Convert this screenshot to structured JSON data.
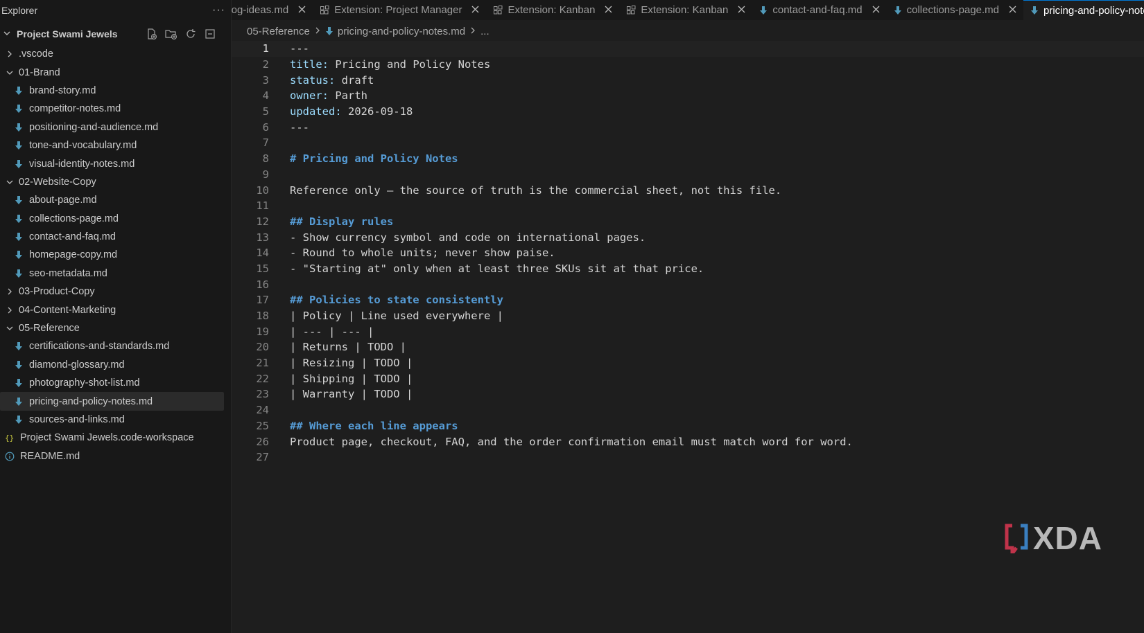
{
  "sidebar": {
    "title": "Explorer",
    "more_label": "···",
    "workspace": "Project Swami Jewels",
    "tree": [
      {
        "label": ".vscode",
        "kind": "folder",
        "expanded": false,
        "level": 0
      },
      {
        "label": "01-Brand",
        "kind": "folder",
        "expanded": true,
        "level": 0
      },
      {
        "label": "brand-story.md",
        "kind": "md",
        "level": 1
      },
      {
        "label": "competitor-notes.md",
        "kind": "md",
        "level": 1
      },
      {
        "label": "positioning-and-audience.md",
        "kind": "md",
        "level": 1
      },
      {
        "label": "tone-and-vocabulary.md",
        "kind": "md",
        "level": 1
      },
      {
        "label": "visual-identity-notes.md",
        "kind": "md",
        "level": 1
      },
      {
        "label": "02-Website-Copy",
        "kind": "folder",
        "expanded": true,
        "level": 0
      },
      {
        "label": "about-page.md",
        "kind": "md",
        "level": 1
      },
      {
        "label": "collections-page.md",
        "kind": "md",
        "level": 1
      },
      {
        "label": "contact-and-faq.md",
        "kind": "md",
        "level": 1
      },
      {
        "label": "homepage-copy.md",
        "kind": "md",
        "level": 1
      },
      {
        "label": "seo-metadata.md",
        "kind": "md",
        "level": 1
      },
      {
        "label": "03-Product-Copy",
        "kind": "folder",
        "expanded": false,
        "level": 0
      },
      {
        "label": "04-Content-Marketing",
        "kind": "folder",
        "expanded": false,
        "level": 0
      },
      {
        "label": "05-Reference",
        "kind": "folder",
        "expanded": true,
        "level": 0
      },
      {
        "label": "certifications-and-standards.md",
        "kind": "md",
        "level": 1
      },
      {
        "label": "diamond-glossary.md",
        "kind": "md",
        "level": 1
      },
      {
        "label": "photography-shot-list.md",
        "kind": "md",
        "level": 1
      },
      {
        "label": "pricing-and-policy-notes.md",
        "kind": "md",
        "level": 1,
        "selected": true
      },
      {
        "label": "sources-and-links.md",
        "kind": "md",
        "level": 1
      },
      {
        "label": "Project Swami Jewels.code-workspace",
        "kind": "workspace",
        "level": 0
      },
      {
        "label": "README.md",
        "kind": "info",
        "level": 0
      }
    ]
  },
  "tabs": [
    {
      "label": "blog-ideas.md",
      "kind": "md",
      "active": false
    },
    {
      "label": "Extension: Project Manager",
      "kind": "ext",
      "active": false
    },
    {
      "label": "Extension: Kanban",
      "kind": "ext",
      "active": false
    },
    {
      "label": "Extension: Kanban",
      "kind": "ext",
      "active": false
    },
    {
      "label": "contact-and-faq.md",
      "kind": "md",
      "active": false
    },
    {
      "label": "collections-page.md",
      "kind": "md",
      "active": false
    },
    {
      "label": "pricing-and-policy-notes.md",
      "kind": "md",
      "active": true
    }
  ],
  "breadcrumb": {
    "folder": "05-Reference",
    "file": "pricing-and-policy-notes.md",
    "more": "..."
  },
  "editor": {
    "current_line": 1,
    "lines": [
      {
        "n": "1",
        "type": "plain",
        "text": "---"
      },
      {
        "n": "2",
        "type": "kv",
        "key": "title:",
        "value": " Pricing and Policy Notes"
      },
      {
        "n": "3",
        "type": "kv",
        "key": "status:",
        "value": " draft"
      },
      {
        "n": "4",
        "type": "kv",
        "key": "owner:",
        "value": " Parth"
      },
      {
        "n": "5",
        "type": "kv",
        "key": "updated:",
        "value": " 2026-09-18"
      },
      {
        "n": "6",
        "type": "plain",
        "text": "---"
      },
      {
        "n": "7",
        "type": "plain",
        "text": ""
      },
      {
        "n": "8",
        "type": "heading",
        "text": "# Pricing and Policy Notes"
      },
      {
        "n": "9",
        "type": "plain",
        "text": ""
      },
      {
        "n": "10",
        "type": "plain",
        "text": "Reference only — the source of truth is the commercial sheet, not this file."
      },
      {
        "n": "11",
        "type": "plain",
        "text": ""
      },
      {
        "n": "12",
        "type": "heading",
        "text": "## Display rules"
      },
      {
        "n": "13",
        "type": "plain",
        "text": "- Show currency symbol and code on international pages."
      },
      {
        "n": "14",
        "type": "plain",
        "text": "- Round to whole units; never show paise."
      },
      {
        "n": "15",
        "type": "plain",
        "text": "- \"Starting at\" only when at least three SKUs sit at that price."
      },
      {
        "n": "16",
        "type": "plain",
        "text": ""
      },
      {
        "n": "17",
        "type": "heading",
        "text": "## Policies to state consistently"
      },
      {
        "n": "18",
        "type": "plain",
        "text": "| Policy | Line used everywhere |"
      },
      {
        "n": "19",
        "type": "plain",
        "text": "| --- | --- |"
      },
      {
        "n": "20",
        "type": "plain",
        "text": "| Returns | TODO |"
      },
      {
        "n": "21",
        "type": "plain",
        "text": "| Resizing | TODO |"
      },
      {
        "n": "22",
        "type": "plain",
        "text": "| Shipping | TODO |"
      },
      {
        "n": "23",
        "type": "plain",
        "text": "| Warranty | TODO |"
      },
      {
        "n": "24",
        "type": "plain",
        "text": ""
      },
      {
        "n": "25",
        "type": "heading",
        "text": "## Where each line appears"
      },
      {
        "n": "26",
        "type": "plain",
        "text": "Product page, checkout, FAQ, and the order confirmation email must match word for word."
      },
      {
        "n": "27",
        "type": "plain",
        "text": ""
      }
    ]
  },
  "watermark": {
    "text": "XDA"
  },
  "colors": {
    "accent": "#0078d4",
    "md_icon": "#519aba",
    "heading": "#569cd6",
    "key": "#9cdcfe",
    "workspace_icon": "#cbcb41"
  }
}
